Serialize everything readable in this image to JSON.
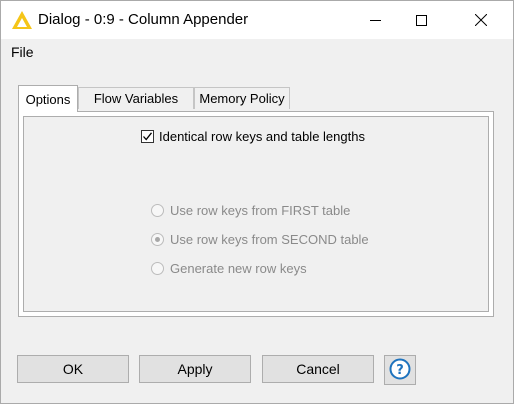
{
  "window": {
    "title": "Dialog - 0:9 - Column Appender",
    "controls": {
      "minimize_icon": "minimize-icon",
      "maximize_icon": "maximize-icon",
      "close_icon": "close-icon"
    },
    "app_icon": "knime-triangle-icon"
  },
  "menu": {
    "items": [
      {
        "label": "File"
      }
    ]
  },
  "tabs": [
    {
      "label": "Options",
      "active": true
    },
    {
      "label": "Flow Variables",
      "active": false
    },
    {
      "label": "Memory Policy",
      "active": false
    }
  ],
  "options": {
    "identical_keys": {
      "label": "Identical row keys and table lengths",
      "checked": true
    },
    "row_key_mode": {
      "enabled": false,
      "selected": 1,
      "choices": [
        {
          "label": "Use row keys from FIRST table"
        },
        {
          "label": "Use row keys from SECOND table"
        },
        {
          "label": "Generate new row keys"
        }
      ]
    }
  },
  "buttons": {
    "ok": "OK",
    "apply": "Apply",
    "cancel": "Cancel",
    "help_icon": "help-icon"
  },
  "colors": {
    "accent_icon": "#f5c518",
    "help_blue": "#1e73be",
    "disabled_text": "#8a8a8a"
  }
}
